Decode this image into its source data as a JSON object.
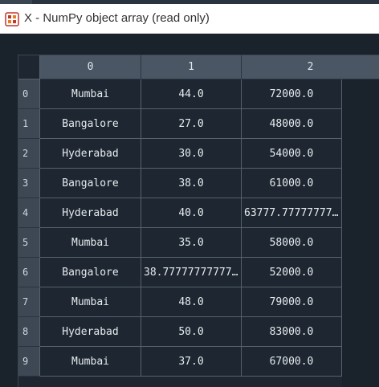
{
  "window": {
    "title": "X - NumPy object array (read only)"
  },
  "table": {
    "columns": [
      "0",
      "1",
      "2"
    ],
    "rows": [
      {
        "index": "0",
        "cells": [
          "Mumbai",
          "44.0",
          "72000.0"
        ]
      },
      {
        "index": "1",
        "cells": [
          "Bangalore",
          "27.0",
          "48000.0"
        ]
      },
      {
        "index": "2",
        "cells": [
          "Hyderabad",
          "30.0",
          "54000.0"
        ]
      },
      {
        "index": "3",
        "cells": [
          "Bangalore",
          "38.0",
          "61000.0"
        ]
      },
      {
        "index": "4",
        "cells": [
          "Hyderabad",
          "40.0",
          "63777.77777777778"
        ]
      },
      {
        "index": "5",
        "cells": [
          "Mumbai",
          "35.0",
          "58000.0"
        ]
      },
      {
        "index": "6",
        "cells": [
          "Bangalore",
          "38.77777777777778",
          "52000.0"
        ]
      },
      {
        "index": "7",
        "cells": [
          "Mumbai",
          "48.0",
          "79000.0"
        ]
      },
      {
        "index": "8",
        "cells": [
          "Hyderabad",
          "50.0",
          "83000.0"
        ]
      },
      {
        "index": "9",
        "cells": [
          "Mumbai",
          "37.0",
          "67000.0"
        ]
      }
    ]
  },
  "colors": {
    "background": "#1a222c",
    "header": "#4a5664",
    "row_header": "#3d4854",
    "grid_line": "#56616d",
    "text": "#e6eaee"
  },
  "icons": {
    "app": "spyder-variable-explorer-icon"
  }
}
